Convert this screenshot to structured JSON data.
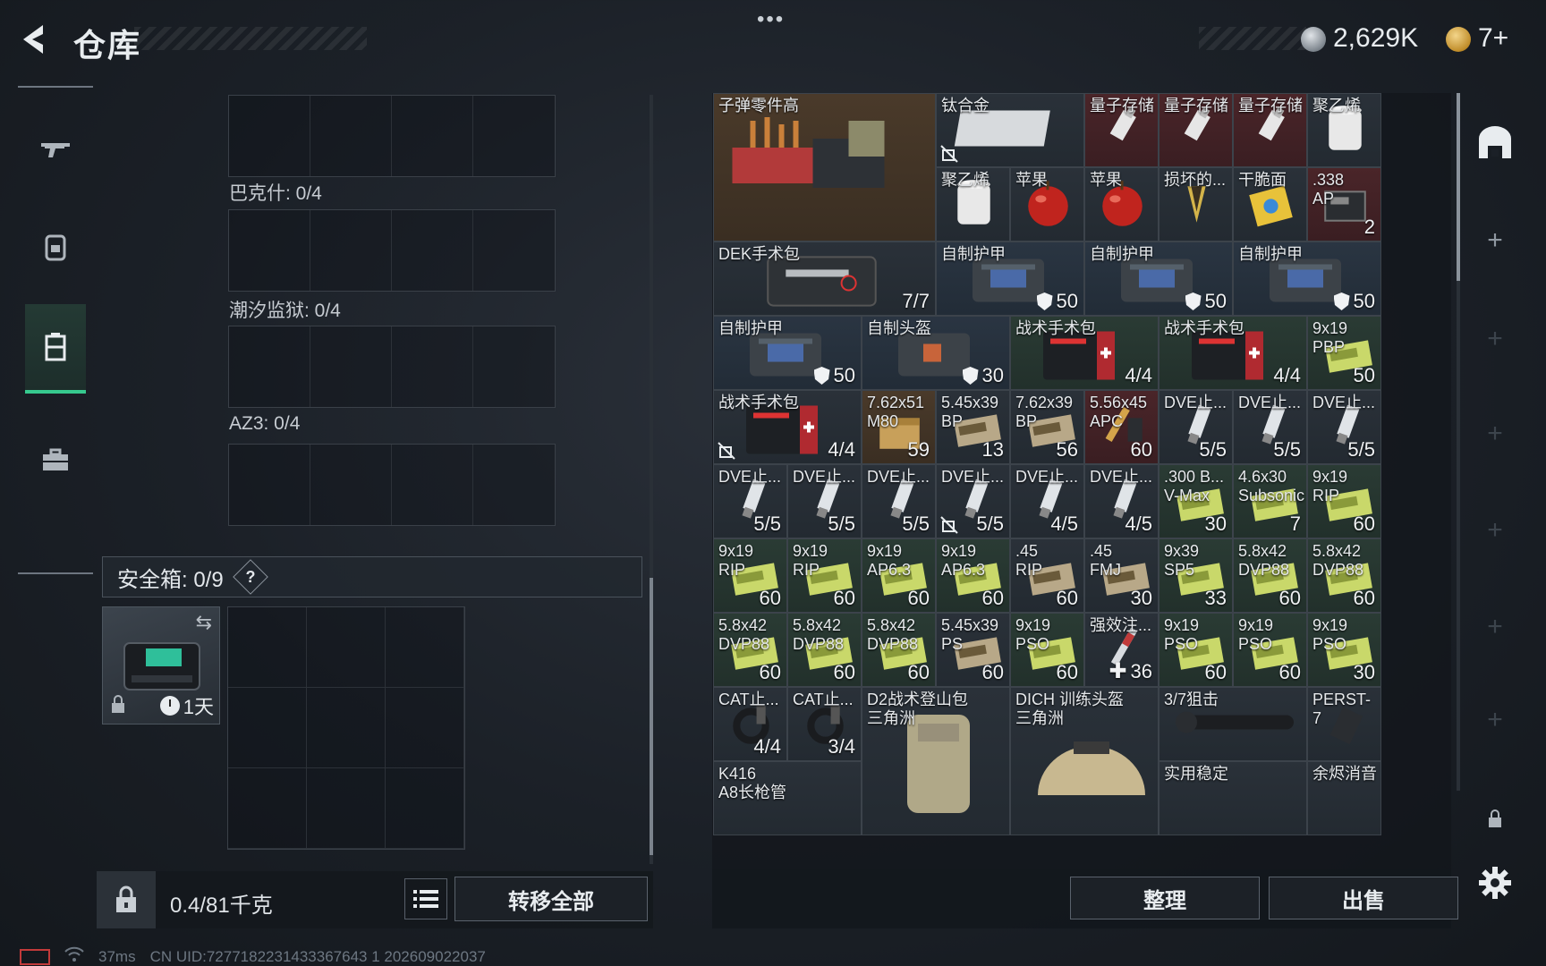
{
  "header": {
    "title": "仓库",
    "currency_silver": "2,629K",
    "currency_gold": "7+"
  },
  "left_tabs": [
    {
      "name": "weapon-tab",
      "icon": "gun-icon",
      "active": false
    },
    {
      "name": "equipment-tab",
      "icon": "backpack-icon",
      "active": false
    },
    {
      "name": "storage-tab",
      "icon": "locker-icon",
      "active": true
    },
    {
      "name": "toolbox-tab",
      "icon": "toolbox-icon",
      "active": false
    }
  ],
  "collections": [
    {
      "label": "巴克什: 0/4"
    },
    {
      "label": "潮汐监狱: 0/4"
    },
    {
      "label": "AZ3: 0/4"
    }
  ],
  "safebox": {
    "label": "安全箱:  0/9",
    "help": "?",
    "timer": "1天"
  },
  "bottom_left": {
    "weight": "0.4/81千克",
    "transfer_all": "转移全部"
  },
  "status": {
    "ping": "37ms",
    "uid": "CN UID:7277182231433367643 1  202609022037"
  },
  "inventory_items": [
    {
      "name": "子弹零件高",
      "count": ""
    },
    {
      "name": "钛合金",
      "count": ""
    },
    {
      "name": "量子存储",
      "count": ""
    },
    {
      "name": "量子存储",
      "count": ""
    },
    {
      "name": "量子存储",
      "count": ""
    },
    {
      "name": "聚乙烯",
      "count": ""
    },
    {
      "name": "聚乙烯",
      "count": ""
    },
    {
      "name": "苹果",
      "count": ""
    },
    {
      "name": "苹果",
      "count": ""
    },
    {
      "name": "损坏的...",
      "count": ""
    },
    {
      "name": "干脆面",
      "count": ""
    },
    {
      "name": ".338\nAP",
      "count": "2"
    },
    {
      "name": "DEK手术包",
      "count": "7/7"
    },
    {
      "name": "自制护甲",
      "count": "50"
    },
    {
      "name": "自制护甲",
      "count": "50"
    },
    {
      "name": "自制护甲",
      "count": "50"
    },
    {
      "name": "自制护甲",
      "count": "50"
    },
    {
      "name": "自制头盔",
      "count": "30"
    },
    {
      "name": "战术手术包",
      "count": "4/4"
    },
    {
      "name": "战术手术包",
      "count": "4/4"
    },
    {
      "name": "9x19\nPBP",
      "count": "50"
    },
    {
      "name": "战术手术包",
      "count": "4/4"
    },
    {
      "name": "7.62x51\nM80",
      "count": "59"
    },
    {
      "name": "5.45x39\nBP",
      "count": "13"
    },
    {
      "name": "7.62x39\nBP",
      "count": "56"
    },
    {
      "name": "5.56x45\nAPC",
      "count": "60"
    },
    {
      "name": "DVE止...",
      "count": "5/5"
    },
    {
      "name": "DVE止...",
      "count": "5/5"
    },
    {
      "name": "DVE止...",
      "count": "5/5"
    },
    {
      "name": "DVE止...",
      "count": "5/5"
    },
    {
      "name": "DVE止...",
      "count": "5/5"
    },
    {
      "name": "DVE止...",
      "count": "5/5"
    },
    {
      "name": "DVE止...",
      "count": "5/5"
    },
    {
      "name": "DVE止...",
      "count": "4/5"
    },
    {
      "name": "DVE止...",
      "count": "4/5"
    },
    {
      "name": ".300 B...\nV-Max",
      "count": "30"
    },
    {
      "name": "4.6x30\nSubsonic",
      "count": "7"
    },
    {
      "name": "9x19\nRIP",
      "count": "60"
    },
    {
      "name": "9x19\nRIP",
      "count": "60"
    },
    {
      "name": "9x19\nRIP",
      "count": "60"
    },
    {
      "name": "9x19\nAP6.3",
      "count": "60"
    },
    {
      "name": "9x19\nAP6.3",
      "count": "60"
    },
    {
      "name": ".45\nRIP",
      "count": "60"
    },
    {
      "name": ".45\nFMJ",
      "count": "30"
    },
    {
      "name": "9x39\nSP5",
      "count": "33"
    },
    {
      "name": "5.8x42\nDVP88",
      "count": "60"
    },
    {
      "name": "5.8x42\nDVP88",
      "count": "60"
    },
    {
      "name": "5.8x42\nDVP88",
      "count": "60"
    },
    {
      "name": "5.8x42\nDVP88",
      "count": "60"
    },
    {
      "name": "5.8x42\nDVP88",
      "count": "60"
    },
    {
      "name": "5.45x39\nPS",
      "count": "60"
    },
    {
      "name": "9x19\nPSO",
      "count": "60"
    },
    {
      "name": "强效注...",
      "count": "36"
    },
    {
      "name": "9x19\nPSO",
      "count": "60"
    },
    {
      "name": "9x19\nPSO",
      "count": "60"
    },
    {
      "name": "9x19\nPSO",
      "count": "30"
    },
    {
      "name": "CAT止...",
      "count": "4/4"
    },
    {
      "name": "CAT止...",
      "count": "3/4"
    },
    {
      "name": "D2战术登山包\n三角洲",
      "count": ""
    },
    {
      "name": "DICH 训练头盔\n三角洲",
      "count": ""
    },
    {
      "name": "3/7狙击",
      "count": ""
    },
    {
      "name": "PERST-7",
      "count": ""
    },
    {
      "name": "K416\nA8长枪管",
      "count": ""
    },
    {
      "name": "实用稳定",
      "count": ""
    },
    {
      "name": "余烬消音",
      "count": ""
    }
  ],
  "inv_actions": {
    "sort": "整理",
    "sell": "出售"
  },
  "colors": {
    "accent_green": "#36c98e",
    "rare_red": "#4a2529"
  }
}
